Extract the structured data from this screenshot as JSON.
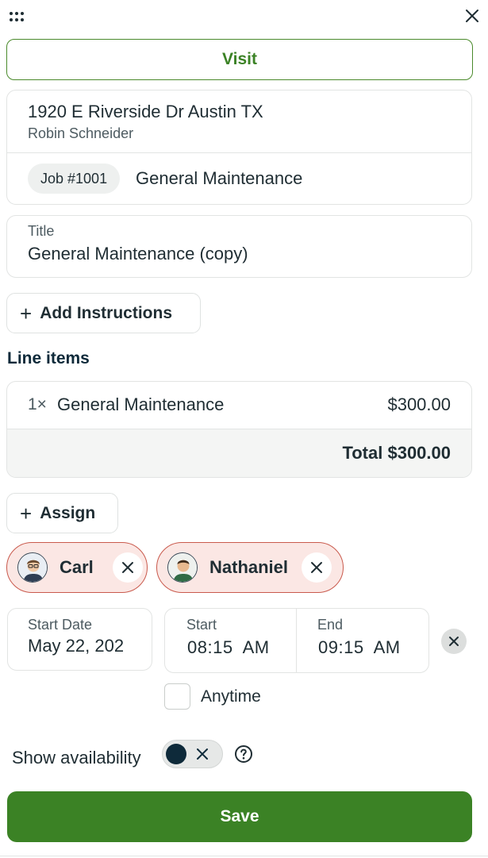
{
  "header": {
    "menu_icon": "grip-dots-icon",
    "close_icon": "close-icon"
  },
  "visit_tab": {
    "label": "Visit"
  },
  "client": {
    "address": "1920 E Riverside Dr Austin TX",
    "name": "Robin Schneider",
    "job_number": "Job #1001",
    "job_title": "General Maintenance"
  },
  "title_field": {
    "label": "Title",
    "value": "General Maintenance (copy)"
  },
  "add_instructions": {
    "icon": "plus-icon",
    "label": "Add Instructions"
  },
  "line_items": {
    "heading": "Line items",
    "items": [
      {
        "qty": "1×",
        "name": "General Maintenance",
        "price": "$300.00"
      }
    ],
    "total": "Total $300.00"
  },
  "assign": {
    "icon": "plus-icon",
    "label": "Assign"
  },
  "assignees": [
    {
      "name": "Carl",
      "remove_icon": "close-icon"
    },
    {
      "name": "Nathaniel",
      "remove_icon": "close-icon"
    }
  ],
  "schedule": {
    "start_date_label": "Start Date",
    "start_date_value": "May 22, 202",
    "start_label": "Start",
    "start_value": "08:15  AM",
    "end_label": "End",
    "end_value": "09:15  AM",
    "clear_icon": "close-icon",
    "anytime_label": "Anytime"
  },
  "availability": {
    "label": "Show availability",
    "toggle_on": false,
    "help_icon": "question-circle-icon"
  },
  "save_button": {
    "label": "Save"
  },
  "colors": {
    "brand_green": "#3b8225",
    "assignee_border": "#c95a4d",
    "assignee_bg": "#fbe7e4",
    "text_primary": "#1f2d33",
    "text_secondary": "#4d5b61"
  }
}
